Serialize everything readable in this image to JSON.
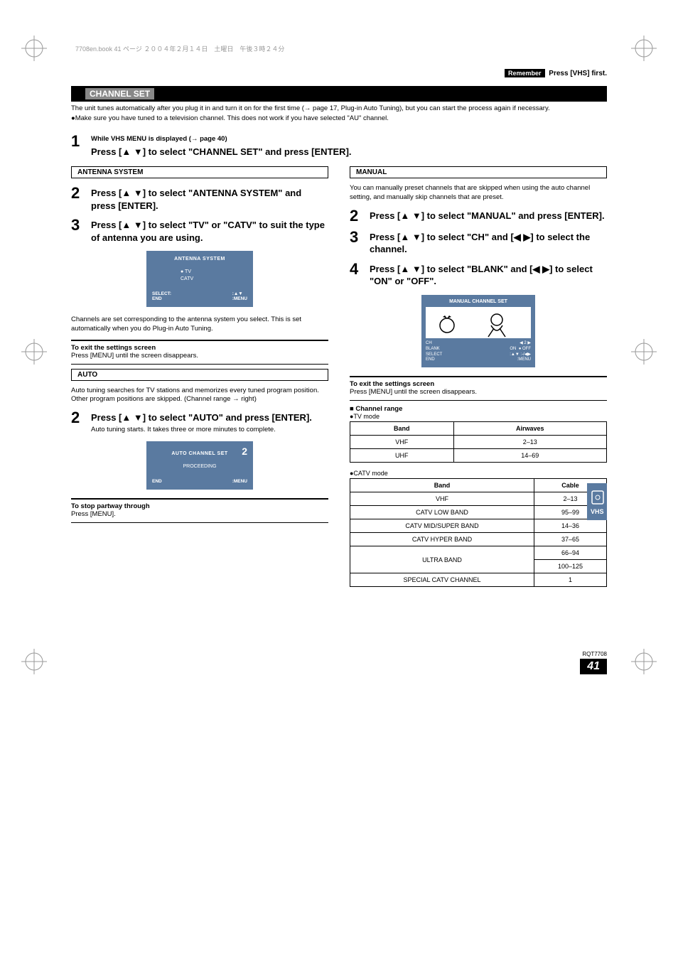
{
  "running_header": "7708en.book  41 ページ  ２００４年２月１４日　土曜日　午後３時２４分",
  "remember": {
    "badge": "Remember",
    "text": "Press [VHS] first."
  },
  "section_title": "CHANNEL SET",
  "intro": {
    "l1": "The unit tunes automatically after you plug it in and turn it on for the first time (→ page 17, Plug-in Auto Tuning), but you can start the process again if necessary.",
    "l2": "●Make sure you have tuned to a television channel. This does not work if you have selected \"AU\" channel."
  },
  "step1": {
    "num": "1",
    "pre": "While VHS MENU is displayed (→ page 40)",
    "main": "Press [▲ ▼] to select \"CHANNEL SET\" and press [ENTER]."
  },
  "left": {
    "heading_antenna": "ANTENNA SYSTEM",
    "s2": {
      "num": "2",
      "main": "Press [▲ ▼] to select \"ANTENNA SYSTEM\" and press [ENTER]."
    },
    "s3": {
      "num": "3",
      "main": "Press [▲ ▼] to select \"TV\" or \"CATV\" to suit the type of antenna you are using."
    },
    "osd_antenna": {
      "title": "ANTENNA SYSTEM",
      "opt1": "● TV",
      "opt2": "   CATV",
      "foot_l": "SELECT:\nEND",
      "foot_r": ":▲▼\n:MENU"
    },
    "after_osd": "Channels are set corresponding to the antenna system you select. This is set automatically when you do Plug-in Auto Tuning.",
    "exit_head": "To exit the settings screen",
    "exit_body": "Press [MENU] until the screen disappears.",
    "heading_auto": "AUTO",
    "auto_intro": "Auto tuning searches for TV stations and memorizes every tuned program position. Other program positions are skipped. (Channel range → right)",
    "auto_s2": {
      "num": "2",
      "main": "Press [▲ ▼] to select \"AUTO\" and press [ENTER].",
      "sub": "Auto tuning starts. It takes three or more minutes to complete."
    },
    "osd_auto": {
      "badge": "2",
      "title": "AUTO CHANNEL SET",
      "body": "PROCEEDING",
      "foot_l": "END",
      "foot_r": ":MENU"
    },
    "stop_head": "To stop partway through",
    "stop_body": "Press [MENU]."
  },
  "right": {
    "heading_manual": "MANUAL",
    "manual_intro": "You can manually preset channels that are skipped when using the auto channel setting, and manually skip channels that are preset.",
    "s2": {
      "num": "2",
      "main": "Press [▲ ▼] to select \"MANUAL\" and press [ENTER]."
    },
    "s3": {
      "num": "3",
      "main": "Press [▲ ▼] to select \"CH\" and [◀ ▶] to select the channel."
    },
    "s4": {
      "num": "4",
      "main": "Press [▲ ▼] to select \"BLANK\" and [◀ ▶] to select \"ON\" or \"OFF\"."
    },
    "osd_manual": {
      "title": "MANUAL CHANNEL SET",
      "l1_l": "CH",
      "l1_r": "2",
      "l2_l": "BLANK",
      "l2_m": "ON",
      "l2_r": "● OFF",
      "l3_l": "SELECT",
      "l3_r": ":▲▼   :-/◀▶",
      "l4_l": "END",
      "l4_r": ":MENU"
    },
    "exit_head": "To exit the settings screen",
    "exit_body": "Press [MENU] until the screen disappears.",
    "ch_range": "Channel range",
    "tv_mode": "●TV mode",
    "catv_mode": "●CATV mode",
    "tv_table": {
      "h1": "Band",
      "h2": "Airwaves",
      "rows": [
        {
          "b": "VHF",
          "v": "2–13"
        },
        {
          "b": "UHF",
          "v": "14–69"
        }
      ]
    },
    "catv_table": {
      "h1": "Band",
      "h2": "Cable",
      "rows": [
        {
          "b": "VHF",
          "v": "2–13"
        },
        {
          "b": "CATV LOW BAND",
          "v": "95–99"
        },
        {
          "b": "CATV MID/SUPER BAND",
          "v": "14–36"
        },
        {
          "b": "CATV HYPER BAND",
          "v": "37–65"
        },
        {
          "b": "ULTRA BAND",
          "v": "66–94",
          "v2": "100–125"
        },
        {
          "b": "SPECIAL CATV CHANNEL",
          "v": "1"
        }
      ]
    }
  },
  "vhs_tab": "VHS",
  "footer": {
    "code": "RQT7708",
    "page": "41"
  }
}
